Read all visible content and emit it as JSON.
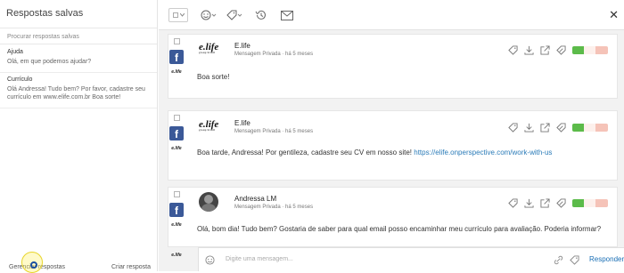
{
  "left_panel": {
    "title": "Respostas salvas",
    "search_placeholder": "Procurar respostas salvas",
    "replies": [
      {
        "title": "Ajuda",
        "body": "Olá, em que podemos ajudar?"
      },
      {
        "title": "Currículo",
        "body": "Olá Andressa! Tudo bem? Por favor, cadastre seu currículo em www.elife.com.br Boa sorte!"
      }
    ],
    "manage_label": "Gerenciar respostas",
    "create_label": "Criar resposta"
  },
  "toolbar": {
    "icons": [
      "checkbox-dropdown",
      "emoji-icon",
      "tag-icon",
      "history-icon",
      "mail-icon"
    ],
    "close_label": "✕"
  },
  "messages": [
    {
      "author": "E.life",
      "channel": "Mensagem Privada",
      "time": "há 5 meses",
      "separator": "·",
      "text": "Boa sorte!",
      "link": "",
      "network": "f",
      "avatar": "elife"
    },
    {
      "author": "E.life",
      "channel": "Mensagem Privada",
      "time": "há 5 meses",
      "separator": "·",
      "text": "Boa tarde, Andressa! Por gentileza, cadastre seu CV em nosso site! ",
      "link": "https://elife.onperspective.com/work-with-us",
      "network": "f",
      "avatar": "elife"
    },
    {
      "author": "Andressa LM",
      "channel": "Mensagem Privada",
      "time": "há 5 meses",
      "separator": "·",
      "text": "Olá, bom dia! Tudo bem? Gostaria de saber para qual email posso encaminhar meu currículo para avaliação. Poderia informar?",
      "link": "",
      "network": "f",
      "avatar": "person"
    }
  ],
  "brand": {
    "logo_text": "e.life",
    "logo_tag": "group brasil"
  },
  "compose": {
    "placeholder": "Digite uma mensagem...",
    "send_label": "Responder"
  },
  "colors": {
    "facebook": "#3b5998",
    "positive": "#5cbb4a",
    "negative": "#f5c3b8",
    "link": "#2a7bb8"
  }
}
